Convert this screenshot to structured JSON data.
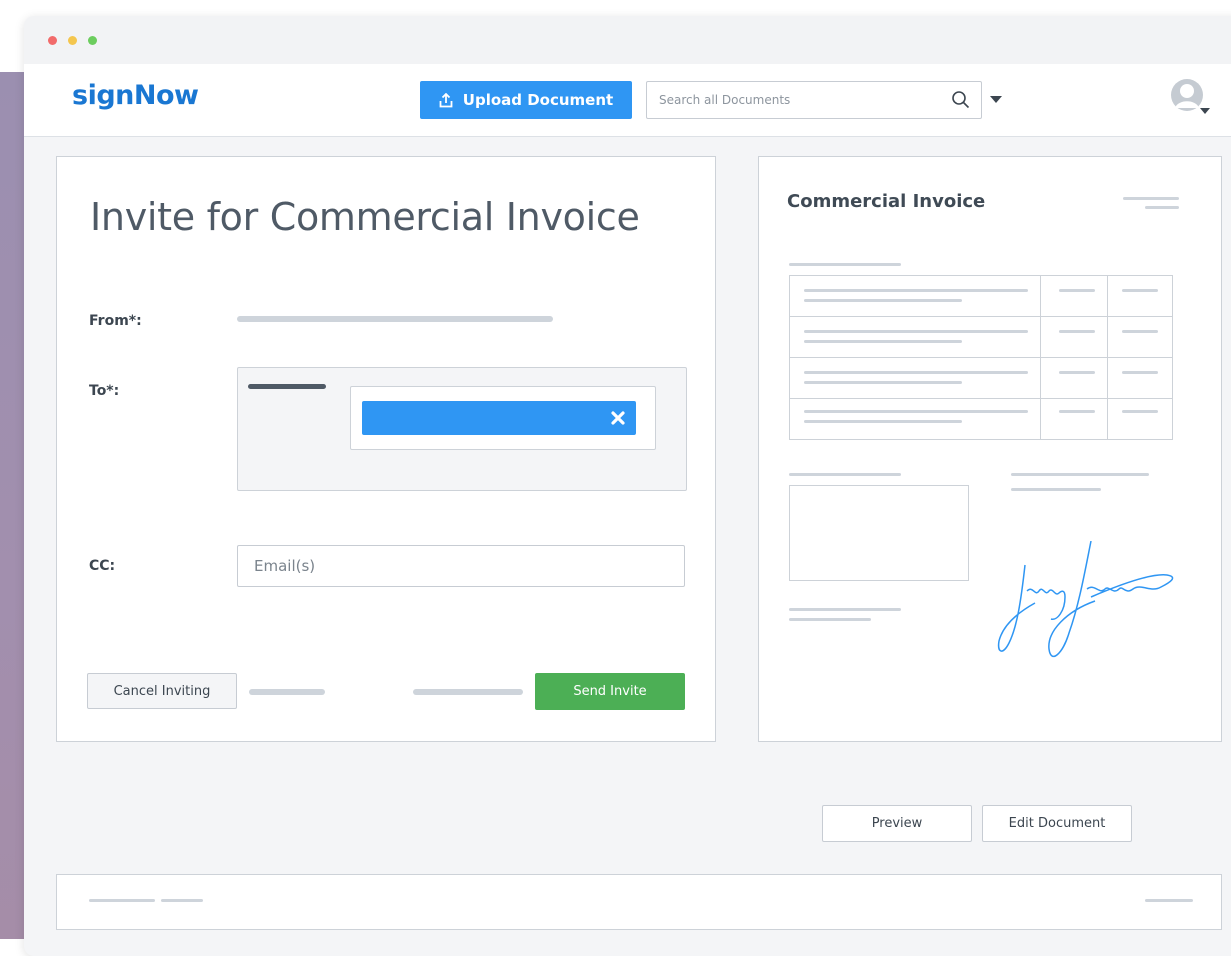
{
  "header": {
    "logo": "signNow",
    "upload_label": "Upload Document",
    "search_placeholder": "Search all Documents"
  },
  "invite": {
    "title": "Invite for Commercial Invoice",
    "from_label": "From*:",
    "to_label": "To*:",
    "cc_label": "CC:",
    "cc_placeholder": "Email(s)",
    "cancel_label": "Cancel Inviting",
    "send_label": "Send Invite"
  },
  "document": {
    "title": "Commercial Invoice",
    "table_rows": 4
  },
  "actions": {
    "preview_label": "Preview",
    "edit_label": "Edit Document"
  },
  "icons": {
    "upload": "upload-icon",
    "search": "search-icon",
    "dropdown": "caret-down-icon",
    "avatar": "user-avatar-icon",
    "remove": "close-icon"
  },
  "colors": {
    "brand": "#1a77d2",
    "primary": "#2f96f3",
    "send": "#4caf55"
  }
}
